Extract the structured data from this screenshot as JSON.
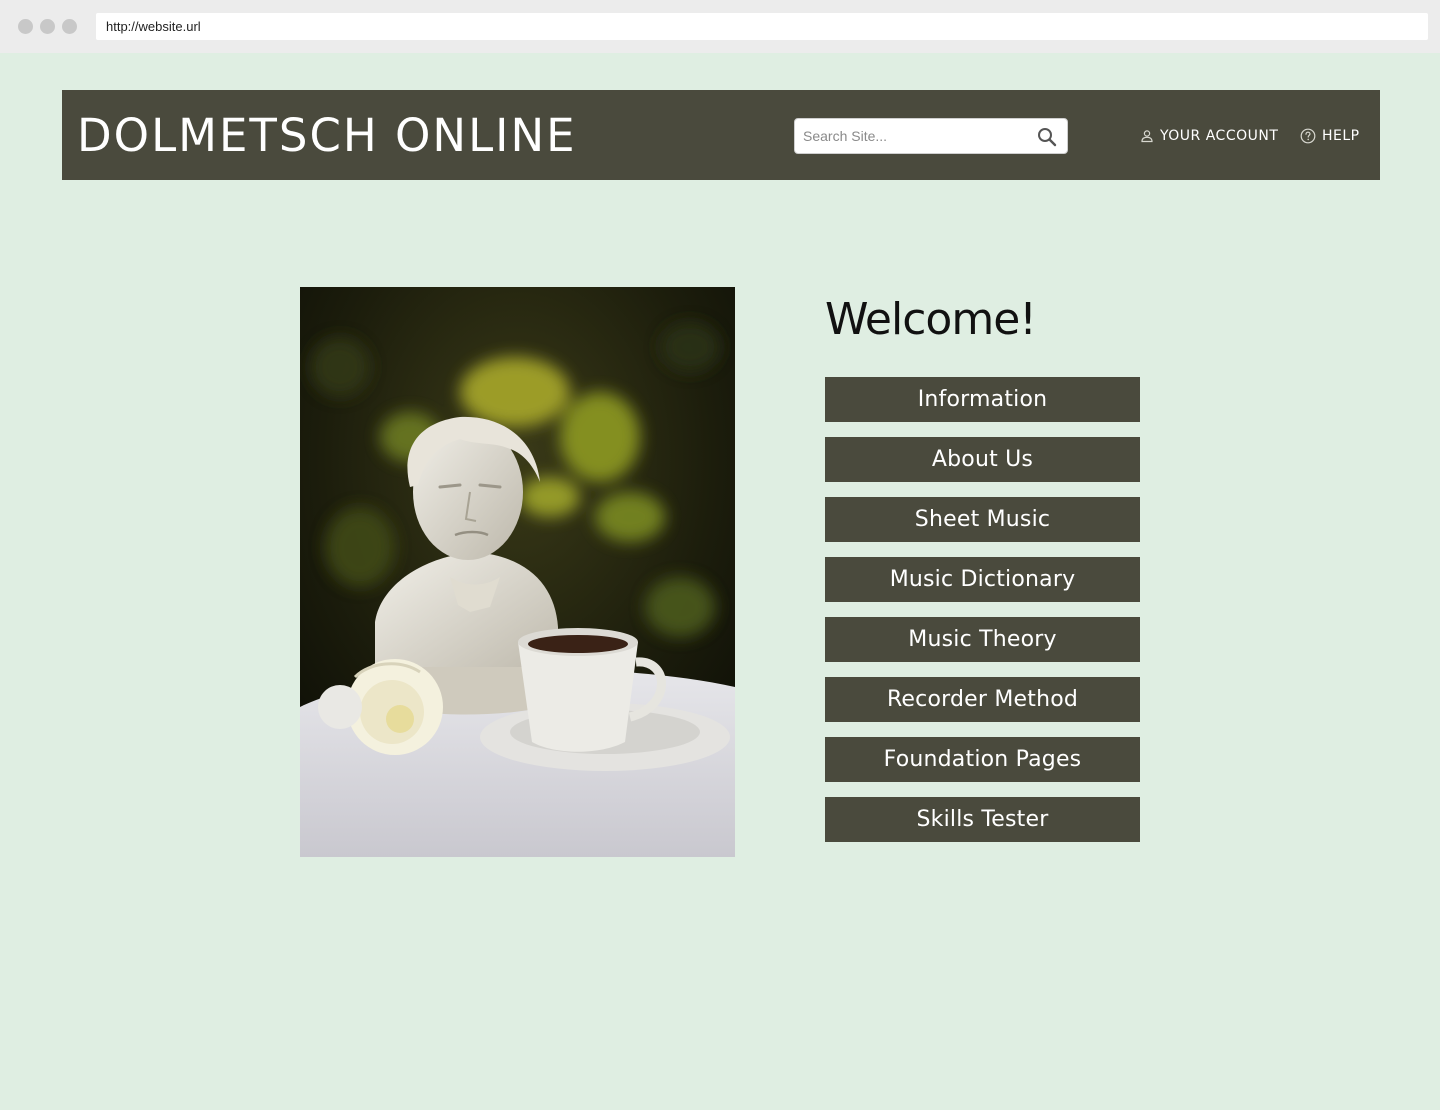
{
  "browser": {
    "url": "http://website.url"
  },
  "header": {
    "site_title": "DOLMETSCH ONLINE",
    "search_placeholder": "Search Site...",
    "account_label": "YOUR ACCOUNT",
    "help_label": "HELP"
  },
  "main": {
    "welcome": "Welcome!",
    "image_alt": "Plaster bust of Beethoven with a cup of coffee and a white rose on a table",
    "menu": [
      {
        "label": "Information"
      },
      {
        "label": "About Us"
      },
      {
        "label": "Sheet Music"
      },
      {
        "label": "Music Dictionary"
      },
      {
        "label": "Music Theory"
      },
      {
        "label": "Recorder Method"
      },
      {
        "label": "Foundation Pages"
      },
      {
        "label": "Skills Tester"
      }
    ]
  },
  "colors": {
    "page_background": "#dfeee2",
    "header_background": "#4a4a3d",
    "button_background": "#4a4a3d"
  },
  "icons": {
    "search": "search-icon",
    "account": "user-icon",
    "help": "help-circle-icon"
  }
}
